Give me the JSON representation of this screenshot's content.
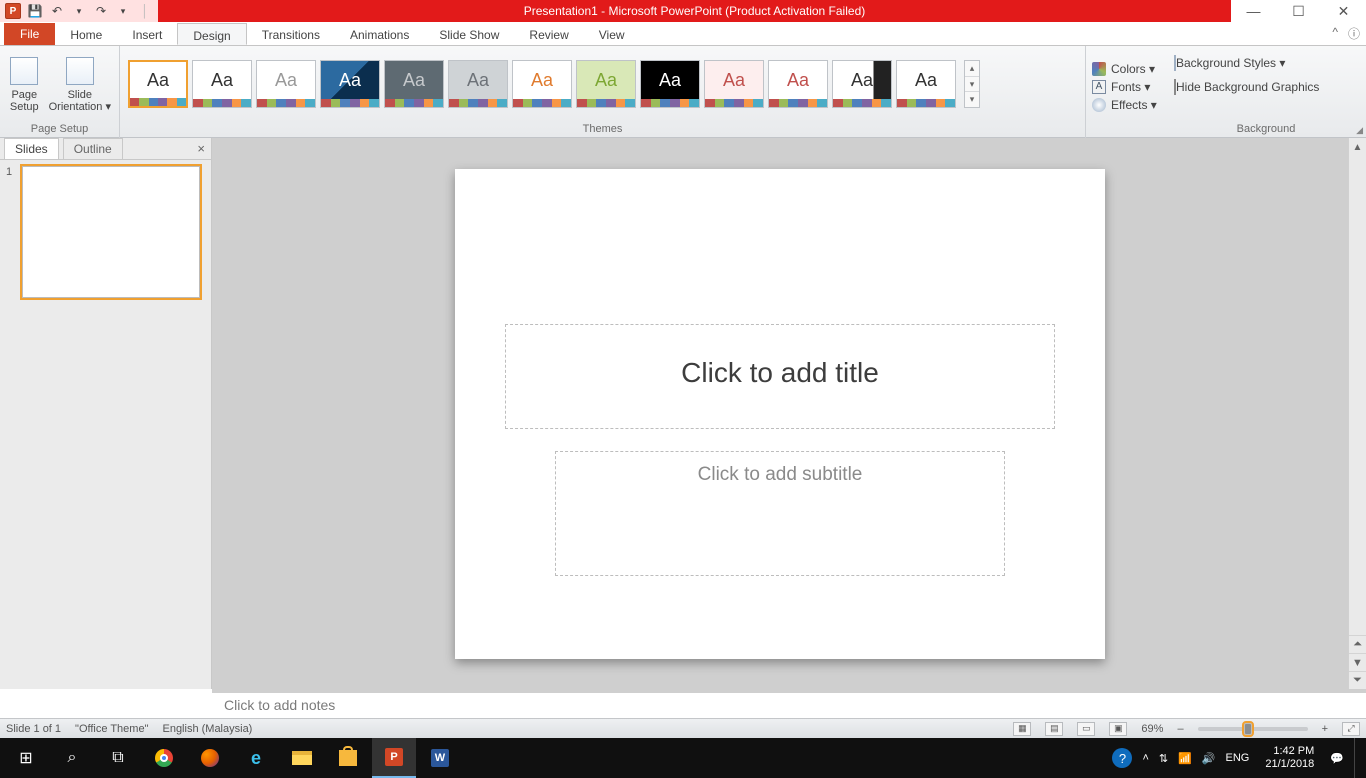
{
  "titlebar": {
    "title": "Presentation1 - Microsoft PowerPoint (Product Activation Failed)",
    "app_badge": "P"
  },
  "window_controls": {
    "min": "—",
    "max": "☐",
    "close": "✕",
    "restore_down": "🗗"
  },
  "qat": {
    "save": "💾",
    "undo": "↶",
    "redo": "↷",
    "more": "▾",
    "sep": "│"
  },
  "ribbon": {
    "file": "File",
    "tabs": [
      "Home",
      "Insert",
      "Design",
      "Transitions",
      "Animations",
      "Slide Show",
      "Review",
      "View"
    ],
    "active_tab": "Design",
    "help": "ⓘ",
    "min_ribbon": "^"
  },
  "groups": {
    "page_setup": {
      "label": "Page Setup",
      "page_setup_btn": "Page\nSetup",
      "orientation_btn": "Slide\nOrientation ▾"
    },
    "themes": {
      "label": "Themes"
    },
    "theme_opts": {
      "colors": "Colors ▾",
      "fonts": "Fonts ▾",
      "effects": "Effects ▾"
    },
    "background": {
      "label": "Background",
      "styles": "Background Styles ▾",
      "hide": "Hide Background Graphics"
    }
  },
  "theme_thumbs": [
    {
      "fg": "#333",
      "bg": "#fff",
      "sel": true
    },
    {
      "fg": "#333",
      "bg": "#fff"
    },
    {
      "fg": "#999",
      "bg": "#fff"
    },
    {
      "fg": "#fff",
      "bg": "linear-gradient(135deg,#2c6aa0 50%,#0b2e4e 50%)",
      "half": true
    },
    {
      "fg": "#c6c9cc",
      "bg": "#5e6a72"
    },
    {
      "fg": "#6d7278",
      "bg": "#cfd3d6"
    },
    {
      "fg": "#e07b2e",
      "bg": "#fff"
    },
    {
      "fg": "#7da733",
      "bg": "#d9e8b7"
    },
    {
      "fg": "#fff",
      "bg": "#000"
    },
    {
      "fg": "#c0504d",
      "bg": "#fdeeee"
    },
    {
      "fg": "#c0504d",
      "bg": "#fff"
    },
    {
      "fg": "#333",
      "bg": "linear-gradient(90deg,#fff 70%,#222 70%)"
    },
    {
      "fg": "#333",
      "bg": "#fff",
      "accent": "#2e75b6"
    }
  ],
  "sidebar": {
    "tabs": {
      "slides": "Slides",
      "outline": "Outline",
      "close": "×"
    },
    "thumb_number": "1"
  },
  "slide": {
    "title_placeholder": "Click to add title",
    "subtitle_placeholder": "Click to add subtitle"
  },
  "notes": {
    "placeholder": "Click to add notes"
  },
  "status": {
    "slide": "Slide 1 of 1",
    "theme": "\"Office Theme\"",
    "lang": "English (Malaysia)",
    "zoom": "69%",
    "plus": "+",
    "minus": "–",
    "fit": "⤢"
  },
  "taskbar": {
    "start": "⊞",
    "search": "⌕",
    "taskview": "⧉",
    "apps": [
      "chrome",
      "firefox",
      "edge",
      "files",
      "store",
      "powerpoint",
      "word"
    ],
    "tray": {
      "help": "?",
      "up": "˄",
      "net": "⇅",
      "wifi": "📶",
      "vol": "🔊",
      "lang": "ENG"
    },
    "clock_time": "1:42 PM",
    "clock_date": "21/1/2018",
    "notif": "💬"
  }
}
